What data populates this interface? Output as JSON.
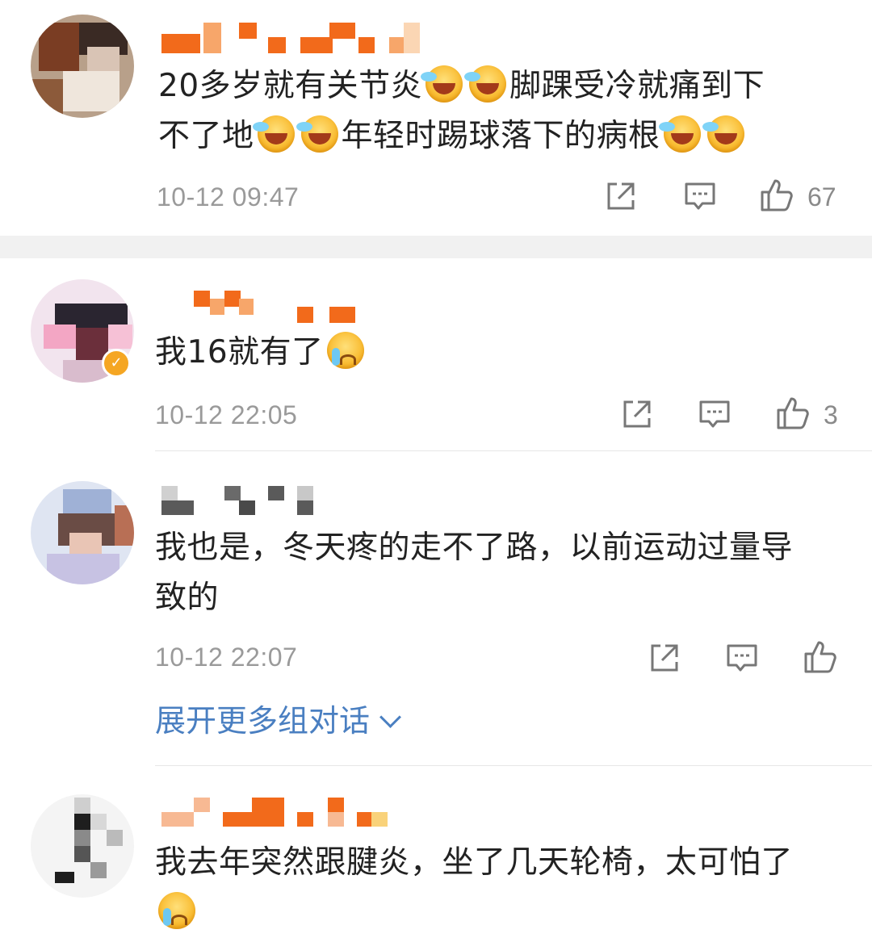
{
  "comments": [
    {
      "text_parts": [
        "20多岁就有关节炎",
        "脚踝受冷就痛到下",
        "不了地",
        "年轻时踢球落下的病根"
      ],
      "emoji_icon": "laugh-cry-emoji",
      "time": "10-12 09:47",
      "likes": "67"
    },
    {
      "text_parts": [
        "我16就有了"
      ],
      "emoji_icon": "crying-emoji",
      "time": "10-12 22:05",
      "likes": "3"
    },
    {
      "text_parts": [
        "我也是，冬天疼的走不了路，以前运动过量导",
        "致的"
      ],
      "time": "10-12 22:07",
      "likes": ""
    },
    {
      "text_parts": [
        "我去年突然跟腱炎，坐了几天轮椅，太可怕了"
      ],
      "emoji_icon": "crying-emoji"
    }
  ],
  "expand_label": "展开更多组对话",
  "icons": {
    "repost": "share-icon",
    "reply": "comment-icon",
    "like": "thumbs-up-icon"
  },
  "colors": {
    "link_blue": "#4a7fc1",
    "muted": "#9a9a9a",
    "verified": "#f5a623"
  }
}
